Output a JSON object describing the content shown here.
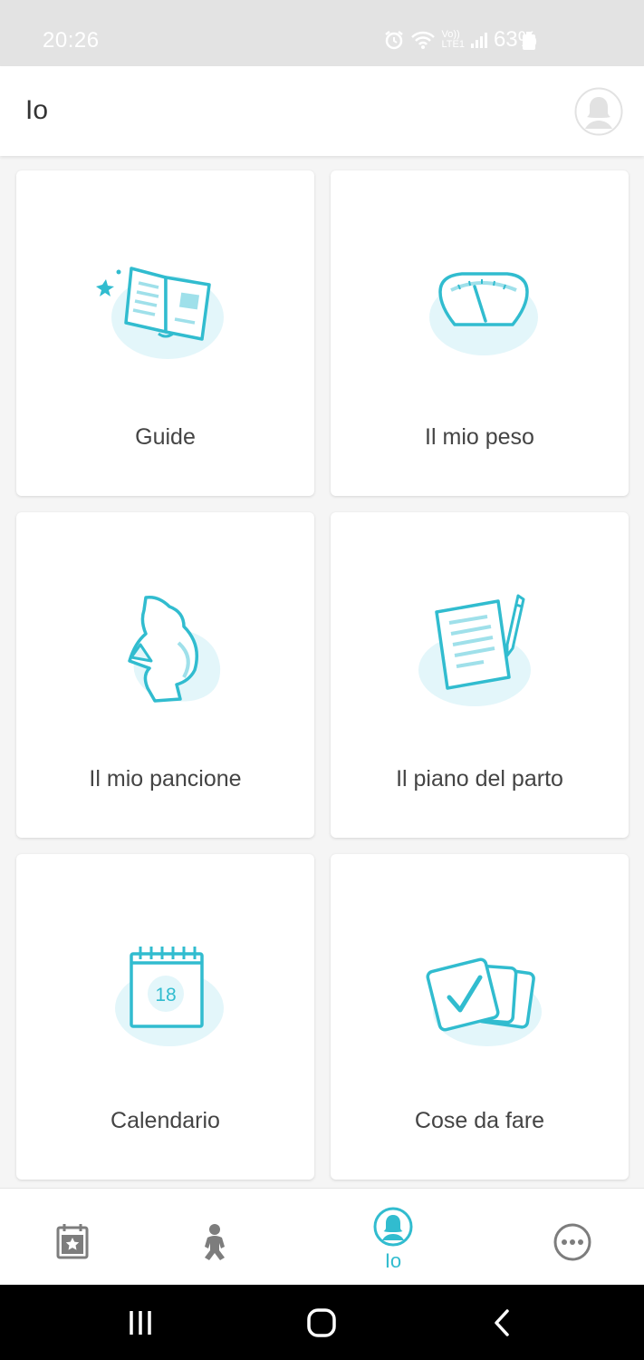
{
  "status_bar": {
    "time": "20:26",
    "battery": "63%",
    "network_label_top": "Vo))",
    "network_label_bottom": "LTE1"
  },
  "header": {
    "title": "Io",
    "avatar_icon": "user-avatar-icon"
  },
  "cards": [
    {
      "label": "Guide",
      "icon": "open-book-icon"
    },
    {
      "label": "Il mio peso",
      "icon": "weight-scale-icon"
    },
    {
      "label": "Il mio pancione",
      "icon": "pregnant-belly-icon"
    },
    {
      "label": "Il piano del parto",
      "icon": "birth-plan-document-icon"
    },
    {
      "label": "Calendario",
      "icon": "calendar-icon",
      "calendar_day": "18"
    },
    {
      "label": "Cose da fare",
      "icon": "todo-checklist-icon"
    }
  ],
  "bottom_nav": {
    "items": [
      {
        "icon": "calendar-star-icon",
        "label": ""
      },
      {
        "icon": "baby-icon",
        "label": ""
      },
      {
        "icon": "profile-icon",
        "label": "Io",
        "active": true
      },
      {
        "icon": "more-icon",
        "label": ""
      }
    ]
  },
  "colors": {
    "accent": "#31bccf",
    "accent_light": "#e3f6fa",
    "text_dark": "#333333",
    "nav_inactive": "#7d7d7d"
  }
}
